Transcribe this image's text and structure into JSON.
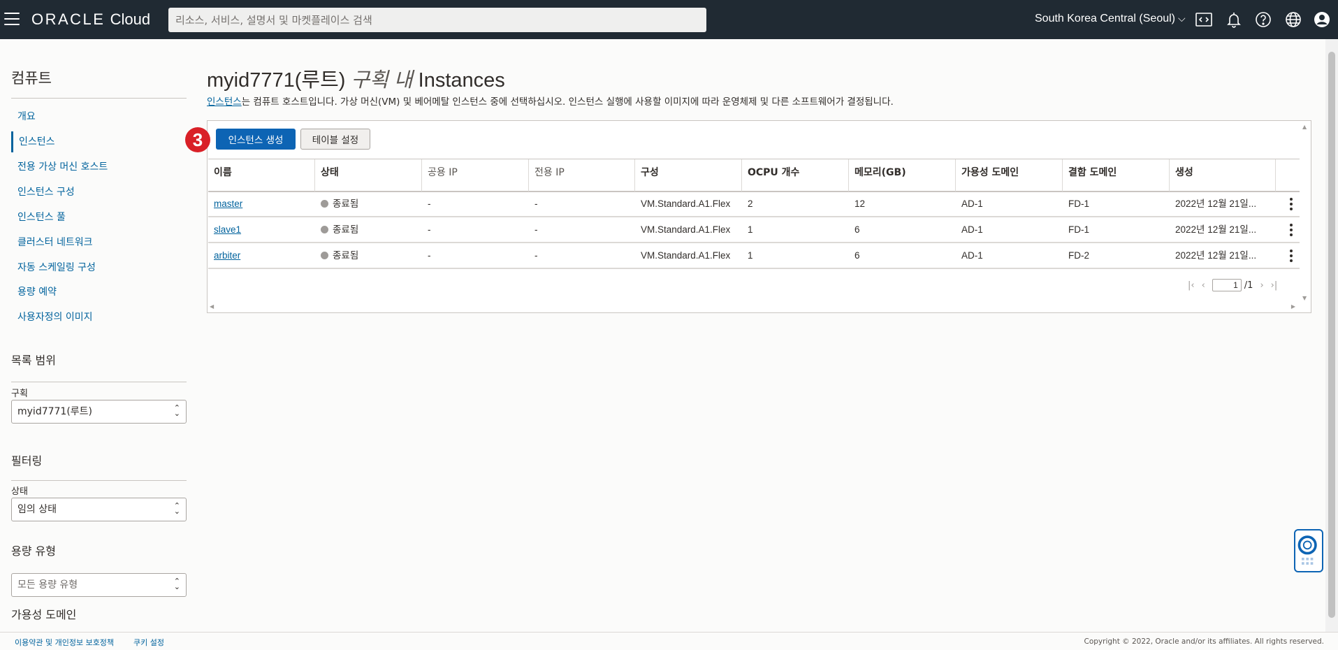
{
  "header": {
    "logo_brand": "ORACLE",
    "logo_product": "Cloud",
    "search_placeholder": "리소스, 서비스, 설명서 및 마켓플레이스 검색",
    "region": "South Korea Central (Seoul)"
  },
  "sidebar": {
    "section_title": "컴퓨트",
    "items": [
      {
        "label": "개요"
      },
      {
        "label": "인스턴스"
      },
      {
        "label": "전용 가상 머신 호스트"
      },
      {
        "label": "인스턴스 구성"
      },
      {
        "label": "인스턴스 풀"
      },
      {
        "label": "클러스터 네트워크"
      },
      {
        "label": "자동 스케일링 구성"
      },
      {
        "label": "용량 예약"
      },
      {
        "label": "사용자정의 이미지"
      }
    ],
    "list_scope_title": "목록 범위",
    "compartment_label": "구획",
    "compartment_value": "myid7771(루트)",
    "filter_title": "필터링",
    "state_label": "상태",
    "state_value": "임의 상태",
    "capacity_title": "용량 유형",
    "capacity_value": "모든 용량 유형",
    "ad_title": "가용성 도메인"
  },
  "main": {
    "title_prefix": "myid7771(루트)",
    "title_in": "구획 내",
    "title_suffix": "Instances",
    "desc_link": "인스턴스",
    "desc_text": "는 컴퓨트 호스트입니다. 가상 머신(VM) 및 베어메탈 인스턴스 중에 선택하십시오. 인스턴스 실행에 사용할 이미지에 따라 운영체제 및 다른 소프트웨어가 결정됩니다.",
    "step_badge": "3",
    "create_button": "인스턴스 생성",
    "table_settings_button": "테이블 설정"
  },
  "table": {
    "columns": [
      "이름",
      "상태",
      "공용 IP",
      "전용 IP",
      "구성",
      "OCPU 개수",
      "메모리(GB)",
      "가용성 도메인",
      "결함 도메인",
      "생성"
    ],
    "rows": [
      [
        "master",
        "종료됨",
        "-",
        "-",
        "VM.Standard.A1.Flex",
        "2",
        "12",
        "AD-1",
        "FD-1",
        "2022년 12월 21일..."
      ],
      [
        "slave1",
        "종료됨",
        "-",
        "-",
        "VM.Standard.A1.Flex",
        "1",
        "6",
        "AD-1",
        "FD-1",
        "2022년 12월 21일..."
      ],
      [
        "arbiter",
        "종료됨",
        "-",
        "-",
        "VM.Standard.A1.Flex",
        "1",
        "6",
        "AD-1",
        "FD-2",
        "2022년 12월 21일..."
      ]
    ],
    "status_color": "#9e9b98"
  },
  "pager": {
    "current": "1",
    "total": "/1"
  },
  "footer": {
    "terms": "이용약관 및 개인정보 보호정책",
    "cookies": "쿠키 설정",
    "copyright": "Copyright © 2022, Oracle and/or its affiliates. All rights reserved."
  },
  "colors": {
    "topbar": "#202a33",
    "primary": "#0d64b4",
    "link": "#02639d",
    "badge": "#d92027"
  }
}
